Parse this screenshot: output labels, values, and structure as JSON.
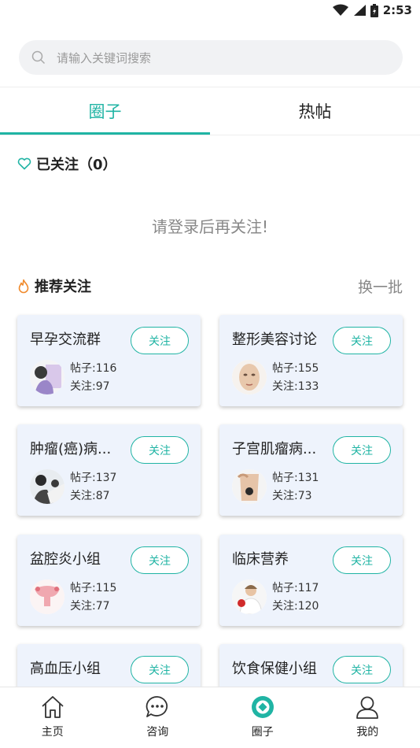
{
  "status_bar": {
    "time": "2:53",
    "icons": [
      "wifi-icon",
      "signal-icon",
      "battery-icon"
    ]
  },
  "search": {
    "placeholder": "请输入关键词搜索",
    "icon": "search-icon"
  },
  "tabs": [
    {
      "label": "圈子",
      "active": true
    },
    {
      "label": "热帖",
      "active": false
    }
  ],
  "followed": {
    "title": "已关注（0）",
    "icon": "heart-outline-icon",
    "empty_hint": "请登录后再关注!"
  },
  "recommend": {
    "title": "推荐关注",
    "icon": "flame-icon",
    "refresh_label": "换一批",
    "cards": [
      {
        "name": "早孕交流群",
        "follow_label": "关注",
        "posts": "帖子:116",
        "follows": "关注:97",
        "avatar": "pregnant-woman-image"
      },
      {
        "name": "整形美容讨论",
        "follow_label": "关注",
        "posts": "帖子:155",
        "follows": "关注:133",
        "avatar": "face-model-image"
      },
      {
        "name": "肿瘤(癌)病...",
        "follow_label": "关注",
        "posts": "帖子:137",
        "follows": "关注:87",
        "avatar": "patient-care-image"
      },
      {
        "name": "子宫肌瘤病...",
        "follow_label": "关注",
        "posts": "帖子:131",
        "follows": "关注:73",
        "avatar": "abdomen-image"
      },
      {
        "name": "盆腔炎小组",
        "follow_label": "关注",
        "posts": "帖子:115",
        "follows": "关注:77",
        "avatar": "pelvis-anatomy-image"
      },
      {
        "name": "临床营养",
        "follow_label": "关注",
        "posts": "帖子:117",
        "follows": "关注:120",
        "avatar": "nurse-apple-image"
      },
      {
        "name": "高血压小组",
        "follow_label": "关注"
      },
      {
        "name": "饮食保健小组",
        "follow_label": "关注"
      }
    ]
  },
  "bottom_nav": [
    {
      "label": "主页",
      "icon": "home-icon",
      "active": false
    },
    {
      "label": "咨询",
      "icon": "chat-bubble-icon",
      "active": false
    },
    {
      "label": "圈子",
      "icon": "circle-logo-icon",
      "active": true
    },
    {
      "label": "我的",
      "icon": "user-icon",
      "active": false
    }
  ],
  "colors": {
    "accent": "#20b4a4",
    "flame": "#f08a2c",
    "card_bg": "#eef3fc"
  }
}
